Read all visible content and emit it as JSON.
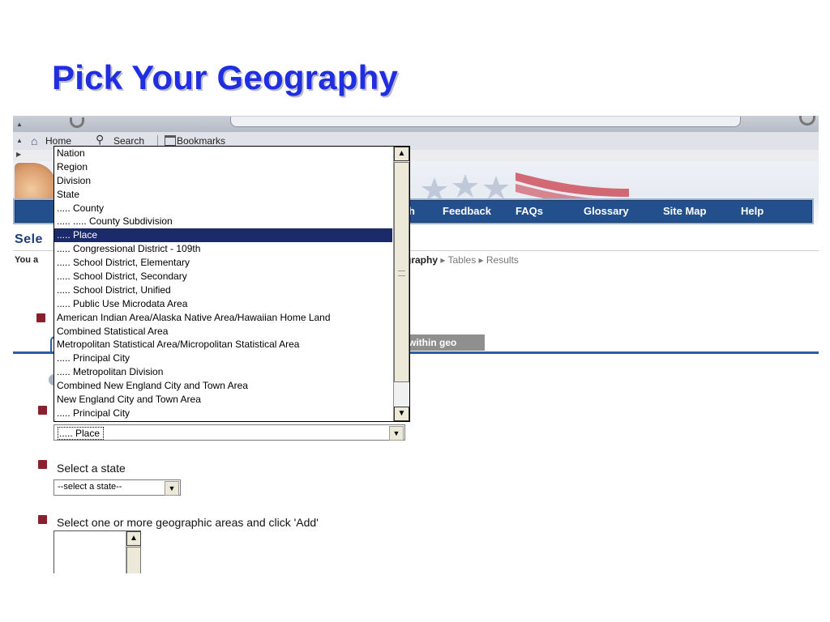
{
  "slide": {
    "title": "Pick Your Geography"
  },
  "browser": {
    "toolbar": {
      "home_label": "Home",
      "search_label": "Search",
      "bookmarks_label": "Bookmarks"
    }
  },
  "site": {
    "nav": {
      "h_partial": "h",
      "feedback": "Feedback",
      "faqs": "FAQs",
      "glossary": "Glossary",
      "site_map": "Site Map",
      "help": "Help"
    },
    "page_title_partial": "Sele",
    "you_are_partial": "You a",
    "breadcrumb": {
      "current": "graphy",
      "tables": "Tables",
      "results": "Results"
    },
    "within_geo_tab": "within geo"
  },
  "form": {
    "geo_type_dropdown": {
      "selected": "..... Place",
      "options": [
        "Nation",
        "Region",
        "Division",
        "State",
        "..... County",
        "..... ..... County Subdivision",
        "..... Place",
        "..... Congressional District - 109th",
        "..... School District, Elementary",
        "..... School District, Secondary",
        "..... School District, Unified",
        "..... Public Use Microdata Area",
        "American Indian Area/Alaska Native Area/Hawaiian Home Land",
        "Combined Statistical Area",
        "Metropolitan Statistical Area/Micropolitan Statistical Area",
        "..... Principal City",
        "..... Metropolitan Division",
        "Combined New England City and Town Area",
        "New England City and Town Area",
        "..... Principal City"
      ],
      "highlighted_index": 6
    },
    "state_label": "Select a state",
    "state_select_value": "--select a state--",
    "areas_label": "Select one or more geographic areas and click 'Add'"
  },
  "colors": {
    "title_blue": "#1f2ee0",
    "nav_blue": "#23508c",
    "bullet_maroon": "#8a1f2e",
    "highlight_navy": "#1b2a6b"
  }
}
